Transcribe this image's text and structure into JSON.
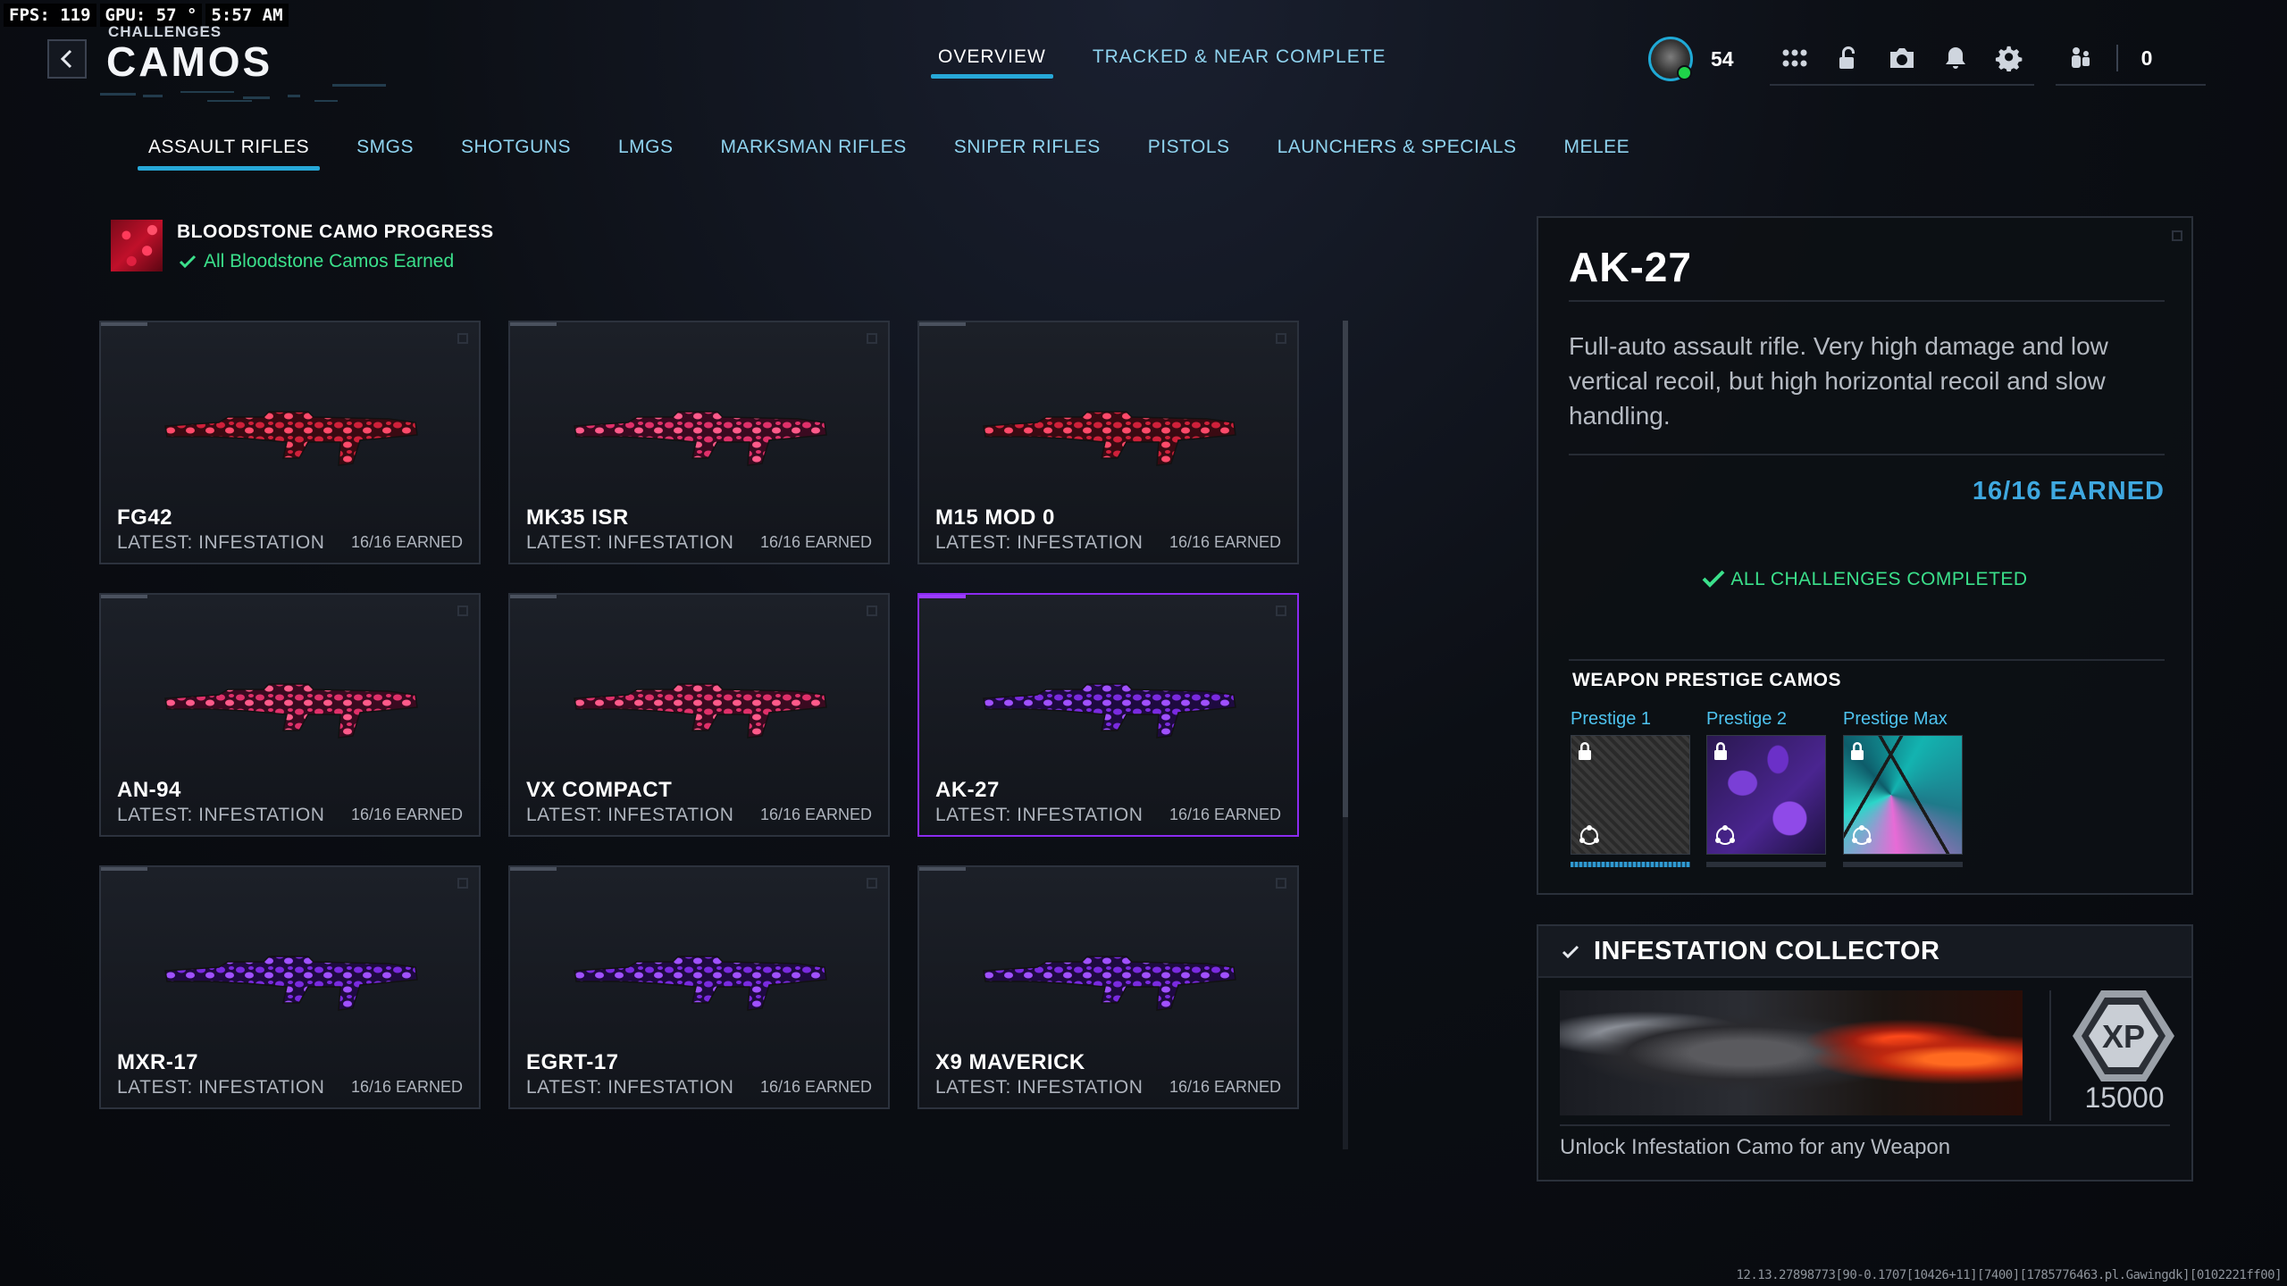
{
  "overlay": {
    "fps": "FPS: 119",
    "gpu": "GPU: 57 °",
    "time": "5:57 AM"
  },
  "header": {
    "breadcrumb": "CHALLENGES",
    "title": "CAMOS",
    "tabs": [
      {
        "label": "OVERVIEW",
        "active": true
      },
      {
        "label": "TRACKED & NEAR COMPLETE",
        "active": false
      }
    ]
  },
  "hud": {
    "player_level": "54",
    "icons": [
      "apps-grid-icon",
      "unlock-icon",
      "camera-icon",
      "bell-icon",
      "gear-icon"
    ],
    "party_count": "0"
  },
  "categories": [
    {
      "label": "ASSAULT RIFLES",
      "active": true
    },
    {
      "label": "SMGS"
    },
    {
      "label": "SHOTGUNS"
    },
    {
      "label": "LMGS"
    },
    {
      "label": "MARKSMAN RIFLES"
    },
    {
      "label": "SNIPER RIFLES"
    },
    {
      "label": "PISTOLS"
    },
    {
      "label": "LAUNCHERS & SPECIALS"
    },
    {
      "label": "MELEE"
    }
  ],
  "bloodstone": {
    "title": "BLOODSTONE CAMO PROGRESS",
    "status": "All Bloodstone Camos Earned"
  },
  "weapons": [
    {
      "name": "FG42",
      "latest": "LATEST: INFESTATION",
      "earned": "16/16 EARNED",
      "camo": "red"
    },
    {
      "name": "MK35 ISR",
      "latest": "LATEST: INFESTATION",
      "earned": "16/16 EARNED",
      "camo": "pink"
    },
    {
      "name": "M15 MOD 0",
      "latest": "LATEST: INFESTATION",
      "earned": "16/16 EARNED",
      "camo": "red"
    },
    {
      "name": "AN-94",
      "latest": "LATEST: INFESTATION",
      "earned": "16/16 EARNED",
      "camo": "pink"
    },
    {
      "name": "VX COMPACT",
      "latest": "LATEST: INFESTATION",
      "earned": "16/16 EARNED",
      "camo": "pink"
    },
    {
      "name": "AK-27",
      "latest": "LATEST: INFESTATION",
      "earned": "16/16 EARNED",
      "camo": "purple",
      "selected": true
    },
    {
      "name": "MXR-17",
      "latest": "LATEST: INFESTATION",
      "earned": "16/16 EARNED",
      "camo": "purple"
    },
    {
      "name": "EGRT-17",
      "latest": "LATEST: INFESTATION",
      "earned": "16/16 EARNED",
      "camo": "purple"
    },
    {
      "name": "X9 MAVERICK",
      "latest": "LATEST: INFESTATION",
      "earned": "16/16 EARNED",
      "camo": "purple"
    }
  ],
  "detail": {
    "weapon_name": "AK-27",
    "description": "Full-auto assault rifle. Very high damage and low vertical recoil, but high horizontal recoil and slow handling.",
    "earned": "16/16 EARNED",
    "status": "ALL CHALLENGES COMPLETED",
    "prestige_title": "WEAPON PRESTIGE CAMOS",
    "prestige": [
      {
        "label": "Prestige 1",
        "locked": true
      },
      {
        "label": "Prestige 2",
        "locked": true
      },
      {
        "label": "Prestige Max",
        "locked": true
      }
    ]
  },
  "challenge": {
    "title": "INFESTATION COLLECTOR",
    "xp_label": "XP",
    "xp_value": "15000",
    "description": "Unlock Infestation Camo for any Weapon"
  },
  "build_string": "12.13.27898773[90-0.1707[10426+11][7400][1785776463.pl.Gawingdk][0102221ff00]",
  "colors": {
    "accent_blue": "#27a8d8",
    "success_green": "#3be08b",
    "selected_purple": "#8b2bf0",
    "earned_blue": "#3fa8e0"
  }
}
